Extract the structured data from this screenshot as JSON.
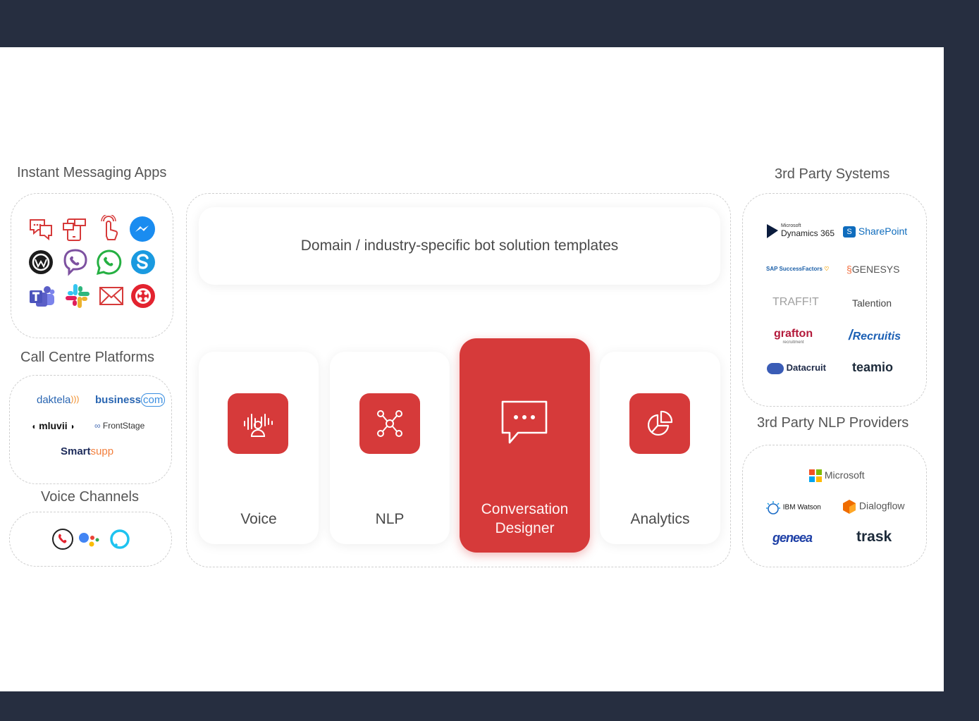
{
  "groups": {
    "instant_messaging": "Instant Messaging Apps",
    "call_centre": "Call Centre Platforms",
    "voice_channels": "Voice Channels",
    "third_party_systems": "3rd Party Systems",
    "nlp_providers": "3rd Party NLP Providers"
  },
  "templates": "Domain / industry-specific bot solution templates",
  "modules": {
    "voice": "Voice",
    "nlp": "NLP",
    "conversation_line1": "Conversation",
    "conversation_line2": "Designer",
    "analytics": "Analytics"
  },
  "call_centre_logos": {
    "daktela": "daktela",
    "businesscom_a": "business",
    "businesscom_b": "com",
    "mluvii": "mluvii",
    "frontstage": "FrontStage",
    "smartsupp_a": "Smart",
    "smartsupp_b": "supp"
  },
  "system_logos": {
    "dynamics_small": "Microsoft",
    "dynamics": "Dynamics 365",
    "sharepoint": "SharePoint",
    "successfactors": "SAP SuccessFactors",
    "genesys": "GENESYS",
    "traffit": "TRAFF!T",
    "talention": "Talention",
    "grafton": "grafton",
    "grafton_sub": "recruitment",
    "recruitis": "Recruitis",
    "datacruit": "Datacruit",
    "teamio": "teamio"
  },
  "nlp_logos": {
    "microsoft": "Microsoft",
    "ibm_watson": "IBM Watson",
    "dialogflow": "Dialogflow",
    "geneea": "geneea",
    "trask": "trask"
  },
  "colors": {
    "frame": "#262e40",
    "accent_red": "#d63a3a",
    "dashed_border": "#cfcfcf"
  }
}
